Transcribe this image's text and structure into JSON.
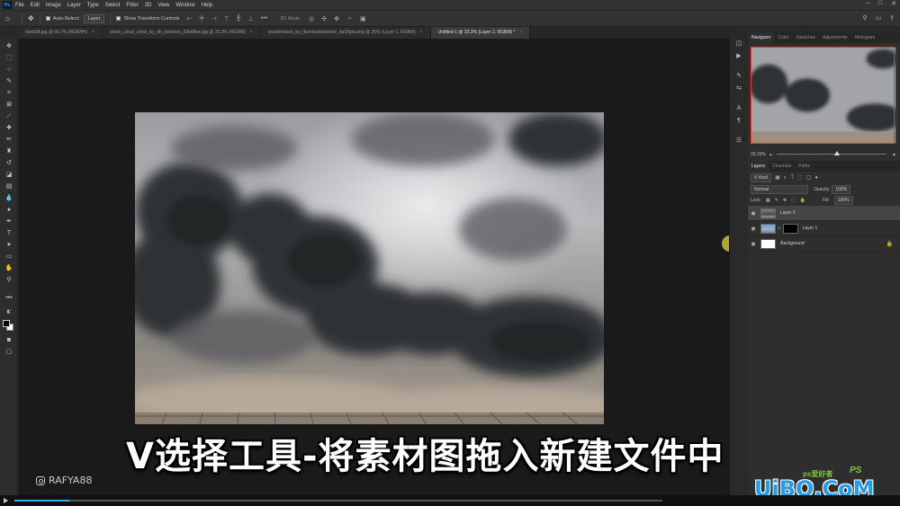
{
  "app": {
    "logo": "Ps"
  },
  "menu": [
    "File",
    "Edit",
    "Image",
    "Layer",
    "Type",
    "Select",
    "Filter",
    "3D",
    "View",
    "Window",
    "Help"
  ],
  "options": {
    "auto_select_label": "Auto-Select:",
    "auto_select_value": "Layer",
    "transform_label": "Show Transform Controls",
    "mode_label": "3D Mode:"
  },
  "tabs": [
    {
      "label": "book08.jpg @ 66,7% (RGB/8#)"
    },
    {
      "label": "storm_cloud_stock_by_dh_textures_d3bd8be.jpg @ 33,3% (RGB/8)"
    },
    {
      "label": "woodendeck_by_illuminatiexplorer_da1f9pb.png @ 25% (Layer 1, RGB/8)"
    },
    {
      "label": "Untitled-1 @ 33,3% (Layer 2, RGB/8) *"
    }
  ],
  "subtitle": "V选择工具-将素材图拖入新建文件中",
  "watermark": "RAFYA88",
  "site_mark": {
    "text": "UiBQ.CoM",
    "sub": "ps爱好者",
    "badge": "PS"
  },
  "navigator": {
    "tabs": [
      "Navigator",
      "Color",
      "Swatches",
      "Adjustments",
      "Histogram"
    ],
    "zoom": "33,33%",
    "zoom_fraction": 0.55
  },
  "layers_panel": {
    "tabs": [
      "Layers",
      "Channels",
      "Paths"
    ],
    "filter_kind": "Kind",
    "blend_mode": "Normal",
    "opacity_label": "Opacity:",
    "opacity_value": "100%",
    "lock_label": "Lock:",
    "fill_label": "Fill:",
    "fill_value": "100%",
    "layers": [
      {
        "name": "Layer 2",
        "selected": true
      },
      {
        "name": "Layer 1",
        "selected": false
      },
      {
        "name": "Background",
        "selected": false
      }
    ]
  },
  "playback": {
    "progress_fraction": 0.085
  }
}
